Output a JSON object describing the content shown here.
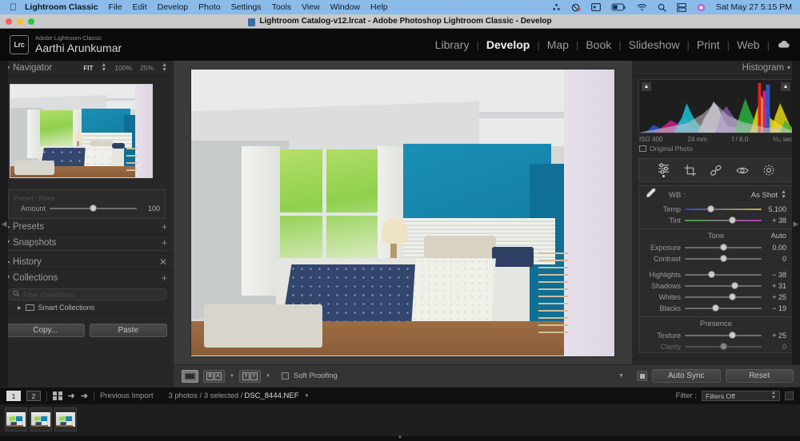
{
  "macbar": {
    "apple_icon": "apple-icon",
    "app_name": "Lightroom Classic",
    "menus": [
      "File",
      "Edit",
      "Develop",
      "Photo",
      "Settings",
      "Tools",
      "View",
      "Window",
      "Help"
    ],
    "status_icons": [
      "bluetooth-icon",
      "control-center-icon",
      "display-icon",
      "battery-icon",
      "wifi-icon",
      "search-icon",
      "screen-share-icon",
      "siri-icon"
    ],
    "clock": "Sat May 27  5:15 PM"
  },
  "window": {
    "title": "Lightroom Catalog-v12.lrcat - Adobe Photoshop Lightroom Classic - Develop",
    "doc_icon": "document-icon"
  },
  "identity": {
    "badge": "Lrc",
    "app_line": "Adobe Lightroom Classic",
    "user": "Aarthi Arunkumar"
  },
  "modules": {
    "items": [
      "Library",
      "Develop",
      "Map",
      "Book",
      "Slideshow",
      "Print",
      "Web"
    ],
    "active": "Develop",
    "cloud_icon": "cloud-icon"
  },
  "left_panel": {
    "navigator": {
      "title": "Navigator",
      "fit": "FIT",
      "zoom_100": "100%",
      "zoom_25": "25%"
    },
    "preset_amount": {
      "preset_label": "Preset : None",
      "amount_label": "Amount",
      "amount_value": "100"
    },
    "sections": [
      {
        "title": "Presets",
        "expanded": false,
        "action": "plus-icon"
      },
      {
        "title": "Snapshots",
        "expanded": true,
        "action": "plus-icon"
      },
      {
        "title": "History",
        "expanded": false,
        "action": "close-icon"
      },
      {
        "title": "Collections",
        "expanded": true,
        "action": "plus-icon"
      }
    ],
    "collections": {
      "filter_placeholder": "Filter Collections",
      "search_icon": "search-icon",
      "items": [
        {
          "label": "Smart Collections",
          "icon": "smart-collection-icon"
        }
      ]
    },
    "buttons": {
      "copy": "Copy...",
      "paste": "Paste"
    }
  },
  "toolbar": {
    "loupe_icon": "loupe-view-icon",
    "before_after": [
      "B",
      "A"
    ],
    "split_view": [
      "Y",
      "Y"
    ],
    "soft_proofing_label": "Soft Proofing",
    "soft_proofing_checked": false,
    "caret_icon": "chevron-down-icon"
  },
  "right_panel": {
    "histogram": {
      "title": "Histogram",
      "iso": "ISO 400",
      "focal": "24 mm",
      "aperture": "f / 8.0",
      "shutter": "⅓₀ sec",
      "original_photo": "Original Photo",
      "clip_left_icon": "shadow-clipping-icon",
      "clip_right_icon": "highlight-clipping-icon"
    },
    "tools": [
      "edit-sliders-icon",
      "crop-icon",
      "healing-brush-icon",
      "red-eye-icon",
      "masking-icon"
    ],
    "basic": {
      "wb_label": "WB :",
      "wb_value": "As Shot",
      "eyedropper_icon": "eyedropper-icon",
      "wb_sliders": [
        {
          "label": "Temp",
          "value": "5,100",
          "pos": 34
        },
        {
          "label": "Tint",
          "value": "+ 38",
          "pos": 62
        }
      ],
      "tone_label": "Tone",
      "auto_label": "Auto",
      "tone_sliders": [
        {
          "label": "Exposure",
          "value": "0.00",
          "pos": 50
        },
        {
          "label": "Contrast",
          "value": "0",
          "pos": 50
        },
        {
          "label": "Highlights",
          "value": "− 38",
          "pos": 35
        },
        {
          "label": "Shadows",
          "value": "+ 31",
          "pos": 65
        },
        {
          "label": "Whites",
          "value": "+ 25",
          "pos": 62
        },
        {
          "label": "Blacks",
          "value": "− 19",
          "pos": 40
        }
      ],
      "presence_label": "Presence",
      "presence_sliders": [
        {
          "label": "Texture",
          "value": "+ 25",
          "pos": 62
        },
        {
          "label": "Clarity",
          "value": "0",
          "pos": 50
        }
      ]
    },
    "footer": {
      "auto_sync": "Auto Sync",
      "reset": "Reset",
      "sync_toggle_icon": "sync-toggle-icon"
    }
  },
  "statusbar": {
    "page_1": "1",
    "page_2": "2",
    "grid_icon": "grid-view-icon",
    "prev_icon": "arrow-left-icon",
    "next_icon": "arrow-right-icon",
    "source": "Previous Import",
    "selection": "3 photos / 3 selected / ",
    "filename": "DSC_8444.NEF",
    "filename_caret": "chevron-down-icon",
    "filter_label": "Filter :",
    "filter_value": "Filters Off",
    "filter_stepper_icon": "stepper-icon",
    "filter_flag_icon": "filter-flag-icon"
  },
  "filmstrip": {
    "thumbnail_count": 3,
    "thumbnails": [
      {
        "name": "thumbnail-1",
        "selected": true
      },
      {
        "name": "thumbnail-2",
        "selected": true
      },
      {
        "name": "thumbnail-3",
        "selected": true
      }
    ],
    "expander_icon": "chevron-down-icon"
  },
  "photo": {
    "alt": "Bedroom interior with teal accent wall, white headboard, navy patterned bedspread, large window with green foliage"
  },
  "colors": {
    "menubar": "#8bbbe8",
    "panel_bg": "#272727",
    "accent_teal": "#127ba3",
    "active_text": "#f2f2f2"
  }
}
